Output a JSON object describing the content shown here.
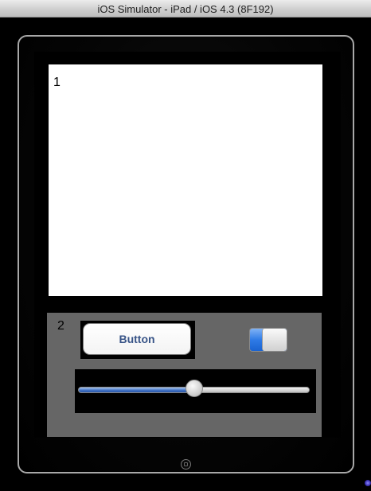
{
  "window": {
    "title": "iOS Simulator - iPad / iOS 4.3 (8F192)"
  },
  "view1": {
    "label": "1"
  },
  "view2": {
    "label": "2",
    "button_label": "Button",
    "switch_on": true,
    "slider_value": 0.5
  },
  "colors": {
    "view1_bg": "#ffffff",
    "view2_bg": "#666666",
    "button_text": "#385487",
    "switch_on": "#2f7be6",
    "slider_fill": "#3e6fc2"
  },
  "icons": {
    "home": "home-button-icon"
  }
}
